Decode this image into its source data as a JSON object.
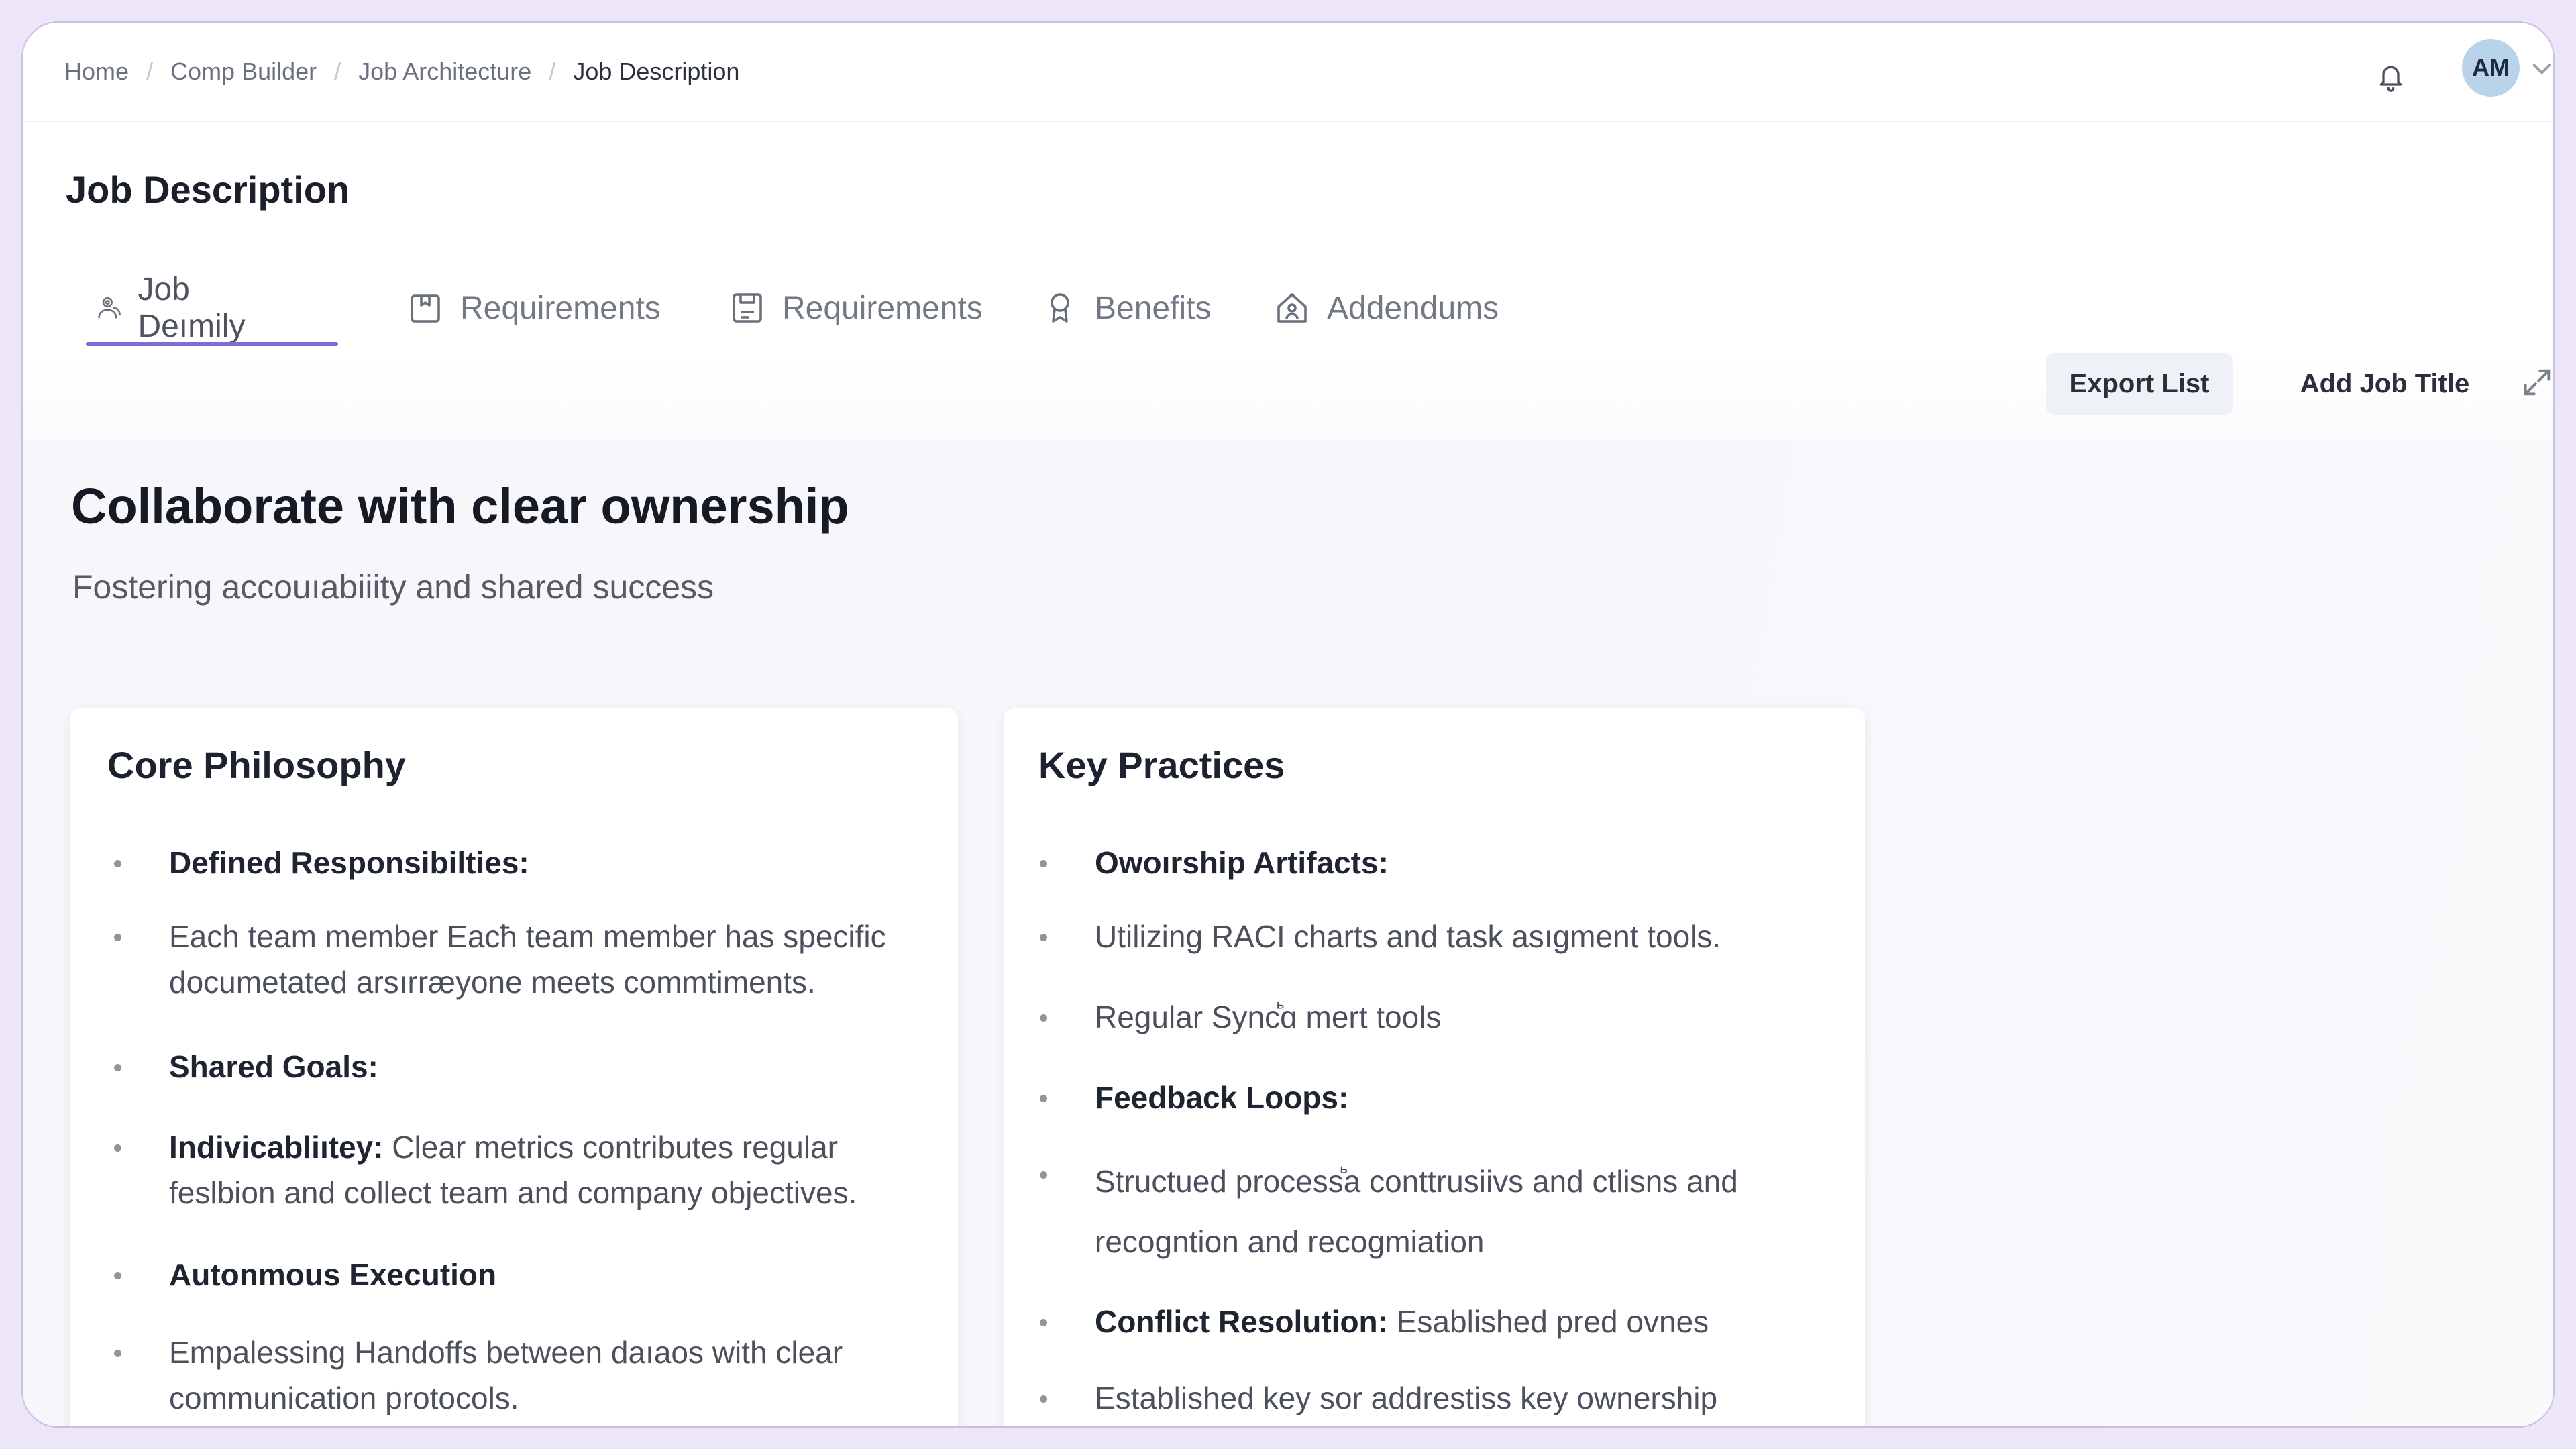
{
  "breadcrumb": {
    "items": [
      "Home",
      "Comp Builder",
      "Job Architecture",
      "Job Description"
    ],
    "separator": "/"
  },
  "header": {
    "notifications_icon": "bell-icon",
    "avatar_initials": "AM",
    "avatar_menu_icon": "chevron-down-icon"
  },
  "page": {
    "title": "Job Description"
  },
  "tabs": [
    {
      "label": "Job Deımily",
      "icon": "user-group-icon",
      "active": true
    },
    {
      "label": "Requirements",
      "icon": "clipboard-icon",
      "active": false
    },
    {
      "label": "Requirements",
      "icon": "document-icon",
      "active": false
    },
    {
      "label": "Benefits",
      "icon": "award-icon",
      "active": false
    },
    {
      "label": "Addendums",
      "icon": "house-user-icon",
      "active": false
    }
  ],
  "toolbar": {
    "export_label": "Export List",
    "add_label": "Add Job Title",
    "expand_icon": "expand-icon"
  },
  "hero": {
    "title": "Collaborate with clear ownership",
    "subtitle": "Fostering accouıabiiity and shared success"
  },
  "cards": {
    "core": {
      "title": "Core Philosophy",
      "items": [
        {
          "bold": "Defined Responsibilties:",
          "text": ""
        },
        {
          "bold": "",
          "text": "Each team member Eacћ team member has specific documetated arsırræyone meets commtiments."
        },
        {
          "bold": "Shared Goals:",
          "text": ""
        },
        {
          "bold": "Indivicabliıtey:",
          "text": " Clear metrics contributes regular feslbion and collect team and company objectives."
        },
        {
          "bold": "Autonmous Execution",
          "text": ""
        },
        {
          "bold": "",
          "text": "Empalessing Handoffs between daıaos with clear communication protocols."
        }
      ]
    },
    "practices": {
      "title": "Key Practices",
      "items": [
        {
          "bold": "Owoırship Artifacts:",
          "text": ""
        },
        {
          "bold": "",
          "text": "Utilizing RACI charts and task asıgment tools."
        },
        {
          "bold": "",
          "text": "Regular Syncꙺɑ mert tools"
        },
        {
          "bold": "Feedback Loops:",
          "text": ""
        },
        {
          "bold": "",
          "text": "Structued processꙺa conttrusiivs and ctlisns and recogntion and recogmiation"
        },
        {
          "bold": "Conflict Resolution:",
          "text": " Esablished pred ovnes"
        },
        {
          "bold": "",
          "text": "Established key sor addrestiss key ownership disputes"
        }
      ]
    }
  }
}
